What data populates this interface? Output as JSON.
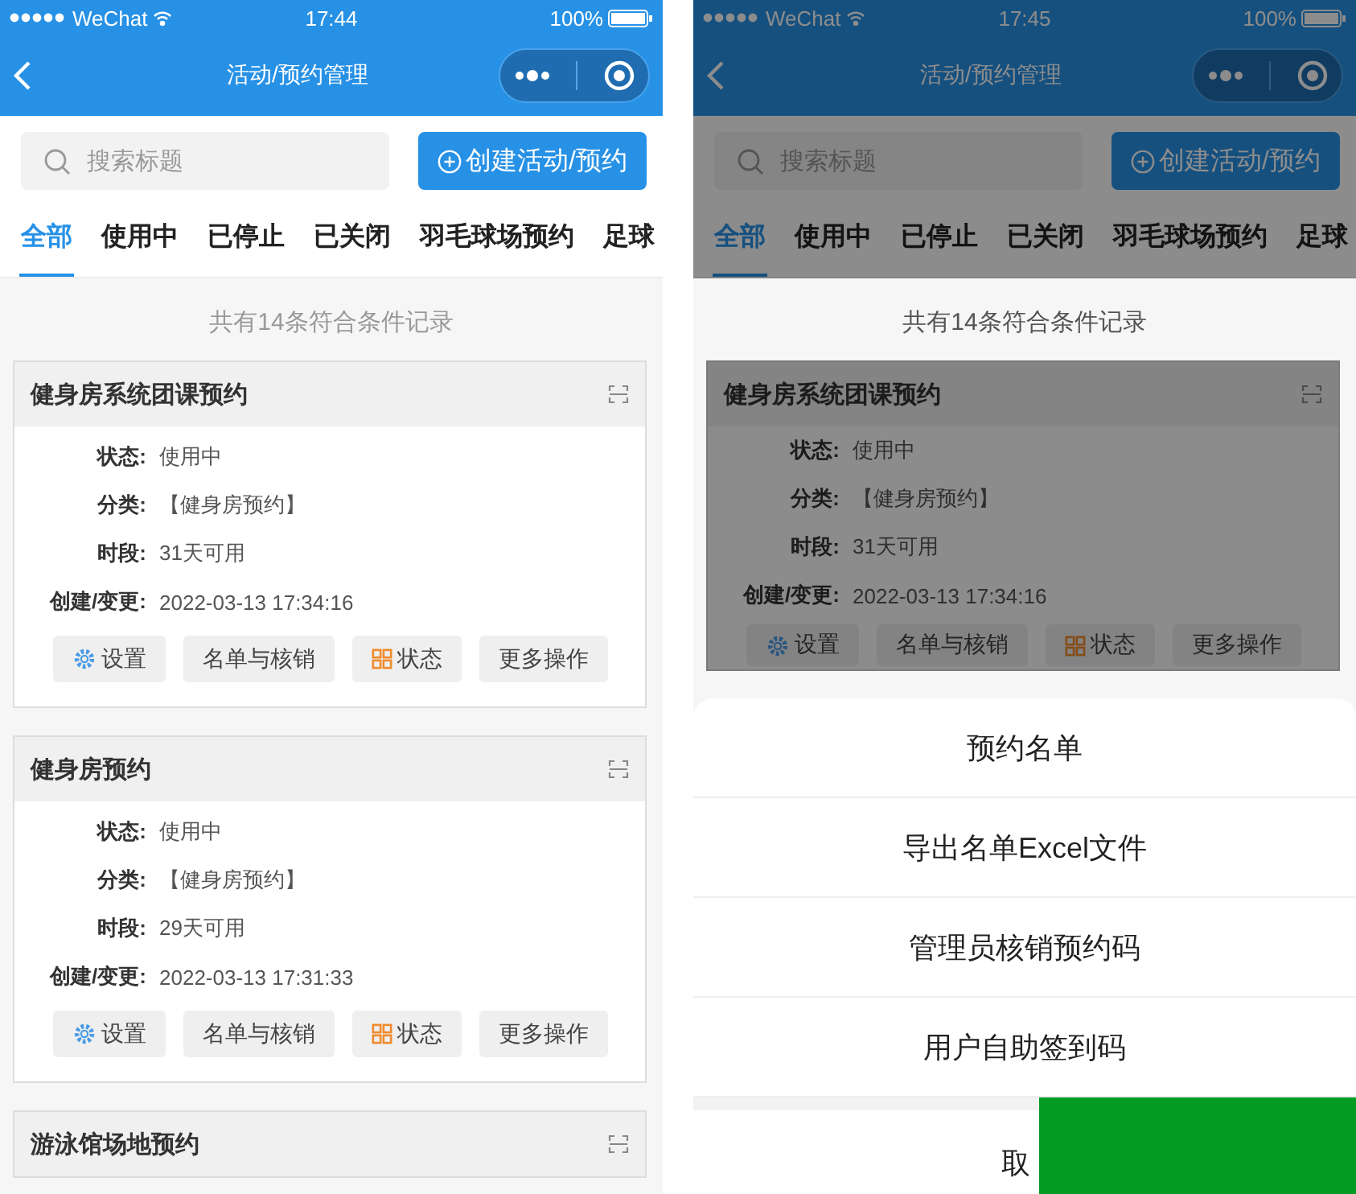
{
  "screens": [
    {
      "status_bar": {
        "carrier": "WeChat",
        "time": "17:44",
        "battery": "100%"
      },
      "nav": {
        "title": "活动/预约管理"
      },
      "search": {
        "placeholder": "搜索标题"
      },
      "create_button": "创建活动/预约",
      "tabs": [
        {
          "label": "全部",
          "selected": true
        },
        {
          "label": "使用中",
          "selected": false
        },
        {
          "label": "已停止",
          "selected": false
        },
        {
          "label": "已关闭",
          "selected": false
        },
        {
          "label": "羽毛球场预约",
          "selected": false
        },
        {
          "label": "足球",
          "selected": false
        }
      ],
      "count_text": "共有14条符合条件记录",
      "cards": [
        {
          "title": "健身房系统团课预约",
          "fields": [
            {
              "label": "状态:",
              "value": "使用中"
            },
            {
              "label": "分类:",
              "value": "【健身房预约】"
            },
            {
              "label": "时段:",
              "value": "31天可用"
            },
            {
              "label": "创建/变更:",
              "value": "2022-03-13 17:34:16"
            }
          ],
          "buttons": [
            {
              "kind": "gear",
              "label": "设置"
            },
            {
              "kind": "plain",
              "label": "名单与核销"
            },
            {
              "kind": "grid",
              "label": "状态"
            },
            {
              "kind": "plain",
              "label": "更多操作"
            }
          ]
        },
        {
          "title": "健身房预约",
          "fields": [
            {
              "label": "状态:",
              "value": "使用中"
            },
            {
              "label": "分类:",
              "value": "【健身房预约】"
            },
            {
              "label": "时段:",
              "value": "29天可用"
            },
            {
              "label": "创建/变更:",
              "value": "2022-03-13 17:31:33"
            }
          ],
          "buttons": [
            {
              "kind": "gear",
              "label": "设置"
            },
            {
              "kind": "plain",
              "label": "名单与核销"
            },
            {
              "kind": "grid",
              "label": "状态"
            },
            {
              "kind": "plain",
              "label": "更多操作"
            }
          ]
        },
        {
          "title": "游泳馆场地预约"
        }
      ]
    },
    {
      "status_bar": {
        "carrier": "WeChat",
        "time": "17:45",
        "battery": "100%"
      },
      "nav": {
        "title": "活动/预约管理"
      },
      "search": {
        "placeholder": "搜索标题"
      },
      "create_button": "创建活动/预约",
      "tabs": [
        {
          "label": "全部",
          "selected": true
        },
        {
          "label": "使用中",
          "selected": false
        },
        {
          "label": "已停止",
          "selected": false
        },
        {
          "label": "已关闭",
          "selected": false
        },
        {
          "label": "羽毛球场预约",
          "selected": false
        },
        {
          "label": "足球",
          "selected": false
        }
      ],
      "count_text": "共有14条符合条件记录",
      "cards": [
        {
          "title": "健身房系统团课预约",
          "fields": [
            {
              "label": "状态:",
              "value": "使用中"
            },
            {
              "label": "分类:",
              "value": "【健身房预约】"
            },
            {
              "label": "时段:",
              "value": "31天可用"
            },
            {
              "label": "创建/变更:",
              "value": "2022-03-13 17:34:16"
            }
          ],
          "buttons": [
            {
              "kind": "gear",
              "label": "设置"
            },
            {
              "kind": "plain",
              "label": "名单与核销"
            },
            {
              "kind": "grid",
              "label": "状态"
            },
            {
              "kind": "plain",
              "label": "更多操作"
            }
          ]
        }
      ],
      "action_sheet": {
        "items": [
          "预约名单",
          "导出名单Excel文件",
          "管理员核销预约码",
          "用户自助签到码"
        ],
        "cancel": "取"
      }
    }
  ]
}
